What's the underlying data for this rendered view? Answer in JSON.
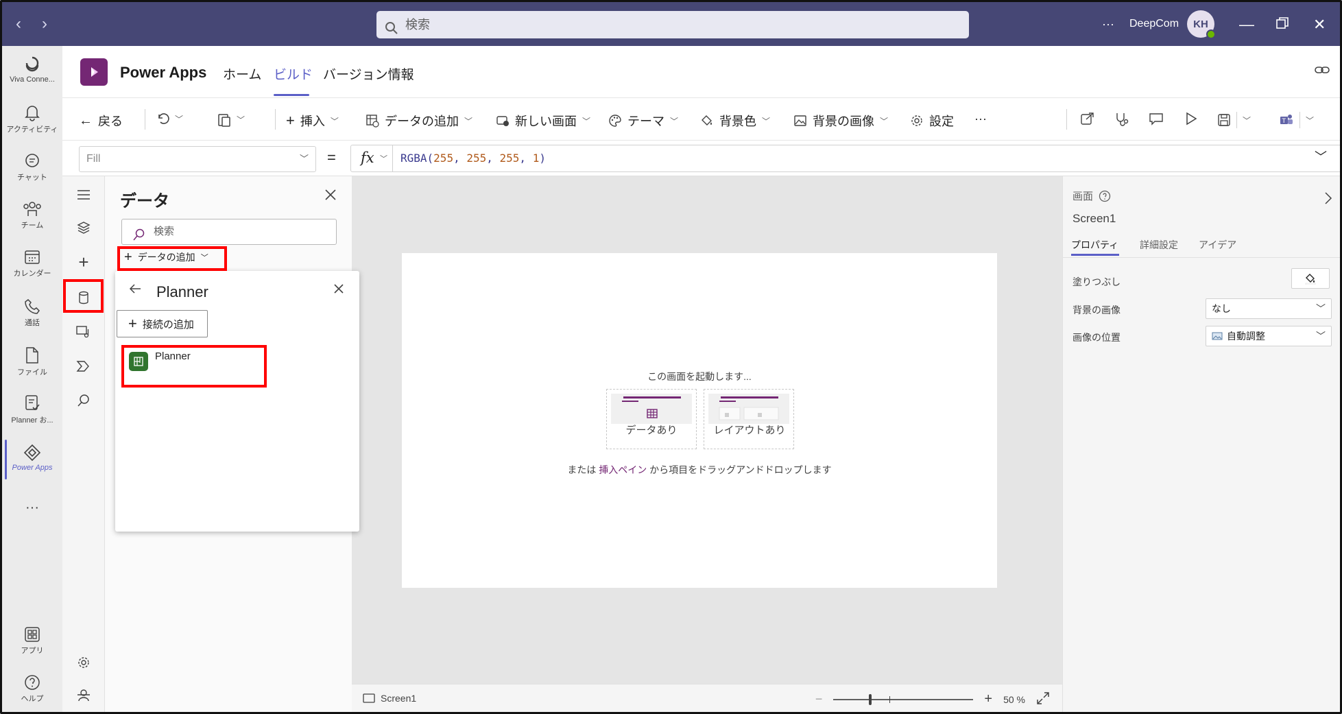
{
  "titlebar": {
    "search_placeholder": "検索",
    "more": "···",
    "org_name": "DeepCom",
    "avatar_initials": "KH"
  },
  "teams_rail": [
    {
      "label": "Viva Conne...",
      "icon": "viva-connections-icon"
    },
    {
      "label": "アクティビティ",
      "icon": "bell-icon"
    },
    {
      "label": "チャット",
      "icon": "chat-icon"
    },
    {
      "label": "チーム",
      "icon": "teams-icon"
    },
    {
      "label": "カレンダー",
      "icon": "calendar-icon"
    },
    {
      "label": "通話",
      "icon": "phone-icon"
    },
    {
      "label": "ファイル",
      "icon": "file-icon"
    },
    {
      "label": "Planner お...",
      "icon": "planner-icon"
    },
    {
      "label": "Power Apps",
      "icon": "power-apps-icon",
      "active": true
    },
    {
      "label": "···",
      "icon": "more-icon"
    },
    {
      "label": "アプリ",
      "icon": "apps-icon"
    },
    {
      "label": "ヘルプ",
      "icon": "help-icon"
    }
  ],
  "app_header": {
    "app_name": "Power Apps",
    "tabs": [
      "ホーム",
      "ビルド",
      "バージョン情報"
    ],
    "active_tab": "ビルド"
  },
  "command_bar": {
    "back": "戻る",
    "insert": "挿入",
    "add_data": "データの追加",
    "new_screen": "新しい画面",
    "theme": "テーマ",
    "background_color": "背景色",
    "background_image": "背景の画像",
    "settings": "設定",
    "more": "···"
  },
  "formula_bar": {
    "property": "Fill",
    "equals": "=",
    "fx": "fx",
    "formula_fn": "RGBA(",
    "formula_args": [
      "255",
      "255",
      "255",
      "1"
    ],
    "formula_close": ")"
  },
  "data_panel": {
    "title": "データ",
    "search_placeholder": "検索",
    "add_data": "データの追加"
  },
  "flyout": {
    "title": "Planner",
    "add_connection": "接続の追加",
    "connector": "Planner"
  },
  "canvas": {
    "start_text": "この画面を起動します...",
    "template_data": "データあり",
    "template_layout": "レイアウトあり",
    "drop_prefix": "または",
    "drop_link": "挿入ペイン",
    "drop_suffix": "から項目をドラッグアンドドロップします"
  },
  "status_bar": {
    "screen": "Screen1",
    "zoom_minus": "−",
    "zoom_plus": "+",
    "zoom_value": "50",
    "zoom_unit": "%",
    "zoom_level_percent": 50
  },
  "properties": {
    "kind": "画面",
    "name": "Screen1",
    "tabs": [
      "プロパティ",
      "詳細設定",
      "アイデア"
    ],
    "fill_label": "塗りつぶし",
    "bg_image_label": "背景の画像",
    "bg_image_value": "なし",
    "image_position_label": "画像の位置",
    "image_position_value": "自動調整"
  },
  "colors": {
    "titlebar": "#464775",
    "accent": "#5b5fc7",
    "powerapps": "#742774",
    "highlight": "#ff0000",
    "planner": "#31752f"
  }
}
